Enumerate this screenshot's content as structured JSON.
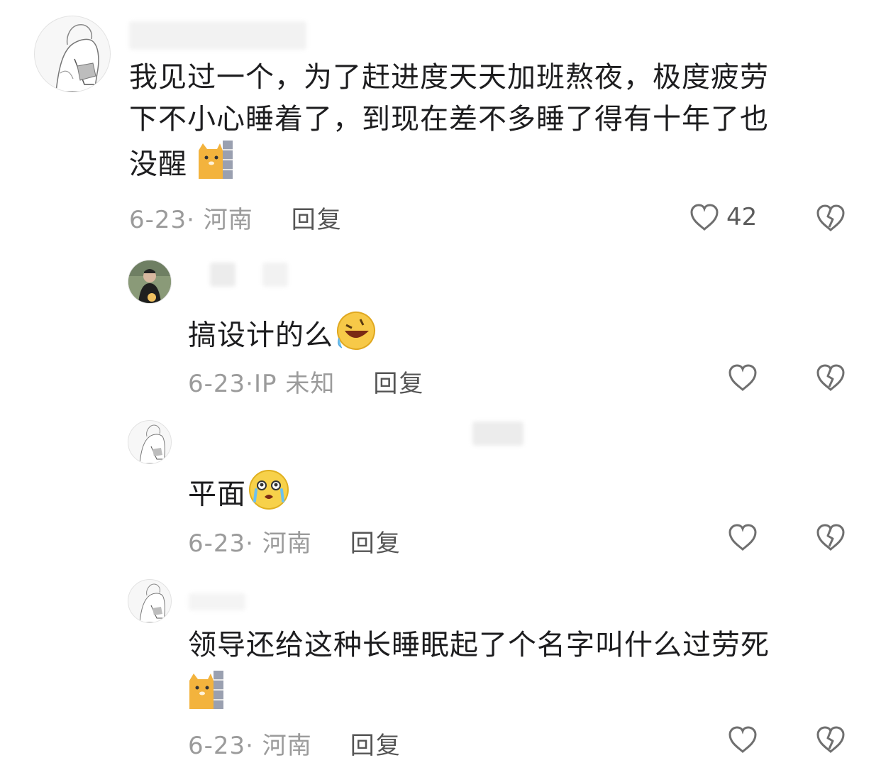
{
  "comments": [
    {
      "text_lines": [
        "我见过一个，为了赶进度天天加班熬夜，极度疲劳",
        "下不小心睡着了，到现在差不多睡了得有十年了也",
        "没醒"
      ],
      "emoji": "cat-peeking-wall-emoji",
      "date": "6-23",
      "location": "河南",
      "reply_label": "回复",
      "like_count": "42"
    },
    {
      "text": "搞设计的么",
      "emoji": "rofl-emoji",
      "date": "6-23",
      "location": "IP 未知",
      "reply_label": "回复"
    },
    {
      "text": "平面",
      "emoji": "crying-emoji",
      "date": "6-23",
      "location": "河南",
      "reply_label": "回复"
    },
    {
      "text": "领导还给这种长睡眠起了个名字叫什么过劳死",
      "emoji": "cat-peeking-wall-emoji",
      "date": "6-23",
      "location": "河南",
      "reply_label": "回复"
    }
  ],
  "separator": "·",
  "icons": {
    "like": "heart-outline-icon",
    "dislike": "broken-heart-icon"
  },
  "colors": {
    "text": "#1d1d1f",
    "meta": "#9b9b9b",
    "reply": "#555555",
    "icon": "#6f6f6f"
  }
}
